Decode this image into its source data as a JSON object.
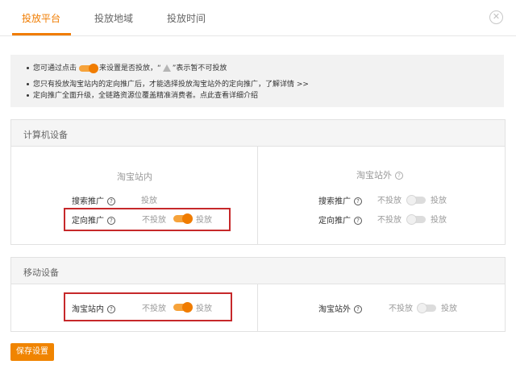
{
  "tabs": [
    {
      "label": "投放平台",
      "active": true
    },
    {
      "label": "投放地域",
      "active": false
    },
    {
      "label": "投放时间",
      "active": false
    }
  ],
  "notice": {
    "line1_before": "您可通过点击",
    "line1_after": "来设置是否投放，“",
    "line1_end": "”表示暂不可投放",
    "line2": "您只有投放淘宝站内的定向推广后，才能选择投放淘宝站外的定向推广，了解详情 >>",
    "line3": "定向推广全面升级，全链路资源位覆盖精准消费者。点此查看详细介绍"
  },
  "computer": {
    "title": "计算机设备",
    "inside": {
      "title": "淘宝站内",
      "rows": [
        {
          "label": "搜索推广",
          "status": "投放",
          "toggle": null
        },
        {
          "label": "定向推广",
          "off_label": "不投放",
          "on_label": "投放",
          "toggle": "on"
        }
      ]
    },
    "outside": {
      "title": "淘宝站外",
      "rows": [
        {
          "label": "搜索推广",
          "off_label": "不投放",
          "on_label": "投放",
          "toggle": "off"
        },
        {
          "label": "定向推广",
          "off_label": "不投放",
          "on_label": "投放",
          "toggle": "off"
        }
      ]
    }
  },
  "mobile": {
    "title": "移动设备",
    "inside": {
      "label": "淘宝站内",
      "off_label": "不投放",
      "on_label": "投放",
      "toggle": "on"
    },
    "outside": {
      "label": "淘宝站外",
      "off_label": "不投放",
      "on_label": "投放",
      "toggle": "off"
    }
  },
  "save_label": "保存设置",
  "colors": {
    "accent": "#f07c00",
    "highlight": "#c6282a"
  }
}
